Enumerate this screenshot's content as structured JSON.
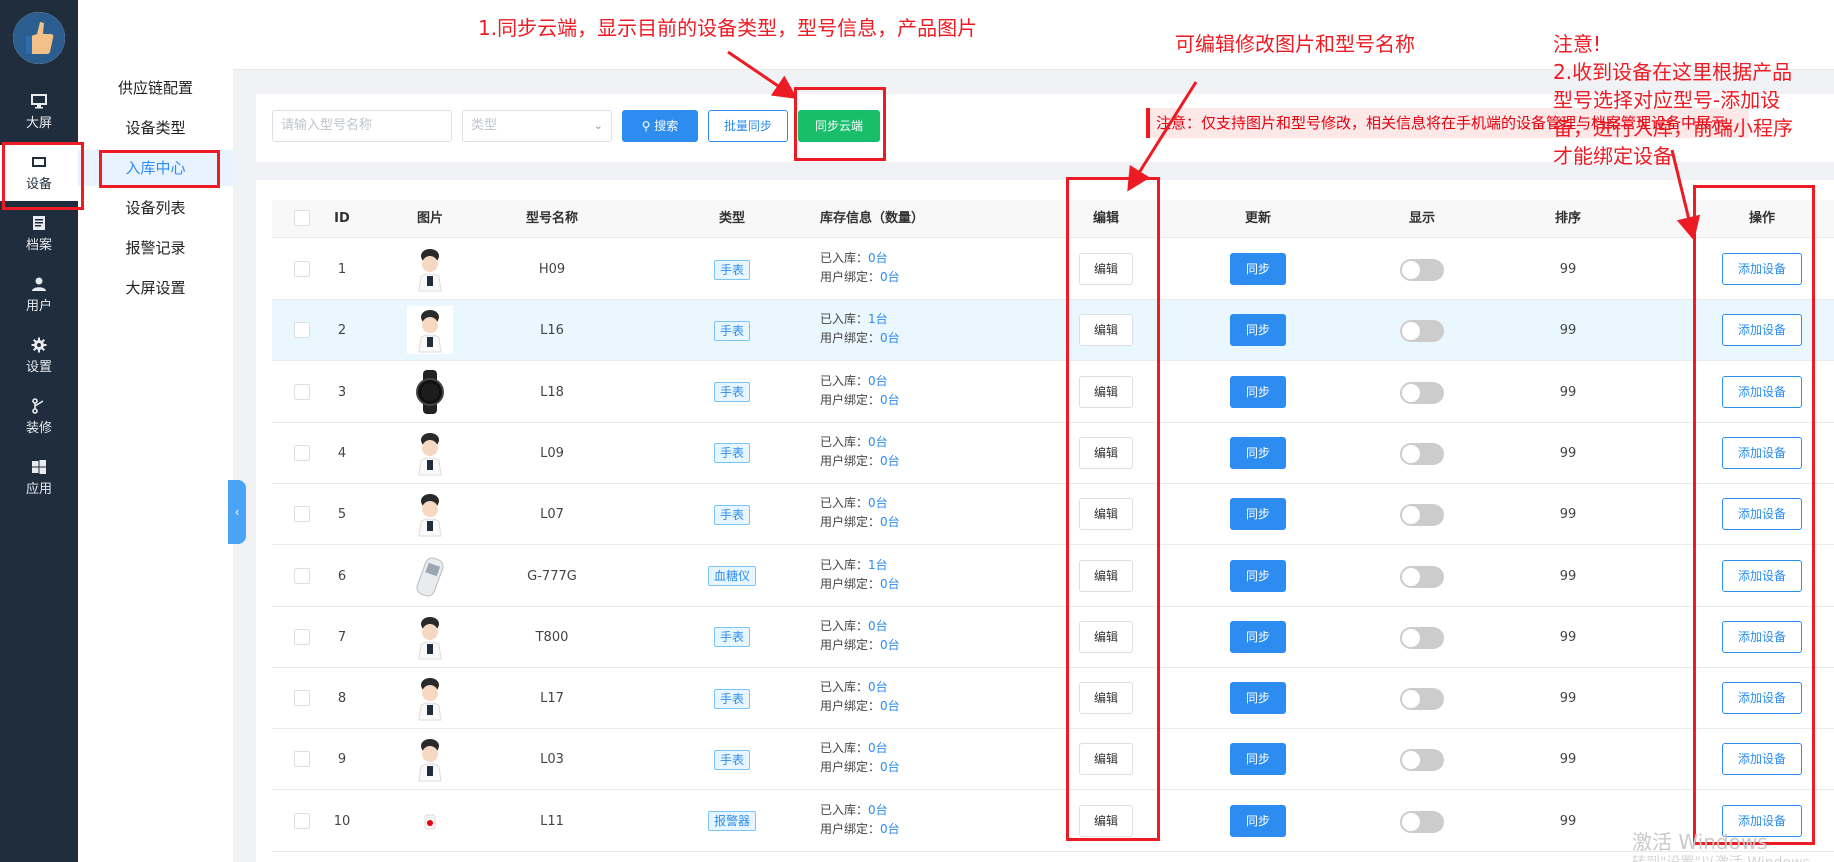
{
  "nav": {
    "items": [
      {
        "label": "大屏",
        "icon": "monitor-icon"
      },
      {
        "label": "设备",
        "icon": "device-icon"
      },
      {
        "label": "档案",
        "icon": "archive-icon"
      },
      {
        "label": "用户",
        "icon": "user-icon"
      },
      {
        "label": "设置",
        "icon": "gear-icon"
      },
      {
        "label": "装修",
        "icon": "brush-icon"
      },
      {
        "label": "应用",
        "icon": "windows-icon"
      }
    ]
  },
  "submenu": {
    "items": [
      "供应链配置",
      "设备类型",
      "入库中心",
      "设备列表",
      "报警记录",
      "大屏设置"
    ]
  },
  "filters": {
    "model_placeholder": "请输入型号名称",
    "type_placeholder": "类型",
    "search_label": "搜索",
    "batch_sync_label": "批量同步",
    "cloud_sync_label": "同步云端",
    "notice": "注意：仅支持图片和型号修改，相关信息将在手机端的设备管理与档案管理设备中展示。"
  },
  "table": {
    "headers": {
      "id": "ID",
      "image": "图片",
      "model": "型号名称",
      "type": "类型",
      "stock": "库存信息（数量）",
      "edit": "编辑",
      "update": "更新",
      "show": "显示",
      "sort": "排序",
      "op": "操作"
    },
    "stock_in_label": "已入库：",
    "bound_label": "用户绑定：",
    "edit_label": "编辑",
    "sync_label": "同步",
    "add_label": "添加设备",
    "rows": [
      {
        "id": "1",
        "model": "H09",
        "type": "手表",
        "stock_in": "0台",
        "bound": "0台",
        "sort": "99",
        "img": "avatar",
        "show": false
      },
      {
        "id": "2",
        "model": "L16",
        "type": "手表",
        "stock_in": "1台",
        "bound": "0台",
        "sort": "99",
        "img": "avatar",
        "show": false
      },
      {
        "id": "3",
        "model": "L18",
        "type": "手表",
        "stock_in": "0台",
        "bound": "0台",
        "sort": "99",
        "img": "watch",
        "show": false
      },
      {
        "id": "4",
        "model": "L09",
        "type": "手表",
        "stock_in": "0台",
        "bound": "0台",
        "sort": "99",
        "img": "avatar",
        "show": false
      },
      {
        "id": "5",
        "model": "L07",
        "type": "手表",
        "stock_in": "0台",
        "bound": "0台",
        "sort": "99",
        "img": "avatar",
        "show": false
      },
      {
        "id": "6",
        "model": "G-777G",
        "type": "血糖仪",
        "stock_in": "1台",
        "bound": "0台",
        "sort": "99",
        "img": "meter",
        "show": false
      },
      {
        "id": "7",
        "model": "T800",
        "type": "手表",
        "stock_in": "0台",
        "bound": "0台",
        "sort": "99",
        "img": "avatar",
        "show": false
      },
      {
        "id": "8",
        "model": "L17",
        "type": "手表",
        "stock_in": "0台",
        "bound": "0台",
        "sort": "99",
        "img": "avatar",
        "show": false
      },
      {
        "id": "9",
        "model": "L03",
        "type": "手表",
        "stock_in": "0台",
        "bound": "0台",
        "sort": "99",
        "img": "avatar",
        "show": false
      },
      {
        "id": "10",
        "model": "L11",
        "type": "报警器",
        "stock_in": "0台",
        "bound": "0台",
        "sort": "99",
        "img": "alarm",
        "show": false
      }
    ]
  },
  "annotations": {
    "cloud": "1.同步云端，显示目前的设备类型，型号信息，产品图片",
    "edit": "可编辑修改图片和型号名称",
    "note_title": "注意!",
    "note_lines": [
      "2.收到设备在这里根据产品",
      "型号选择对应型号-添加设",
      "备，进行入库，前端小程序",
      "才能绑定设备"
    ]
  },
  "watermark": {
    "line1": "激活 Windows",
    "line2": "转到\"设置\"以激活 Windows。"
  },
  "colors": {
    "sidebar": "#1f2d3d",
    "primary": "#2d8cf0",
    "success": "#19be6b",
    "annotation": "#ed1c24"
  }
}
